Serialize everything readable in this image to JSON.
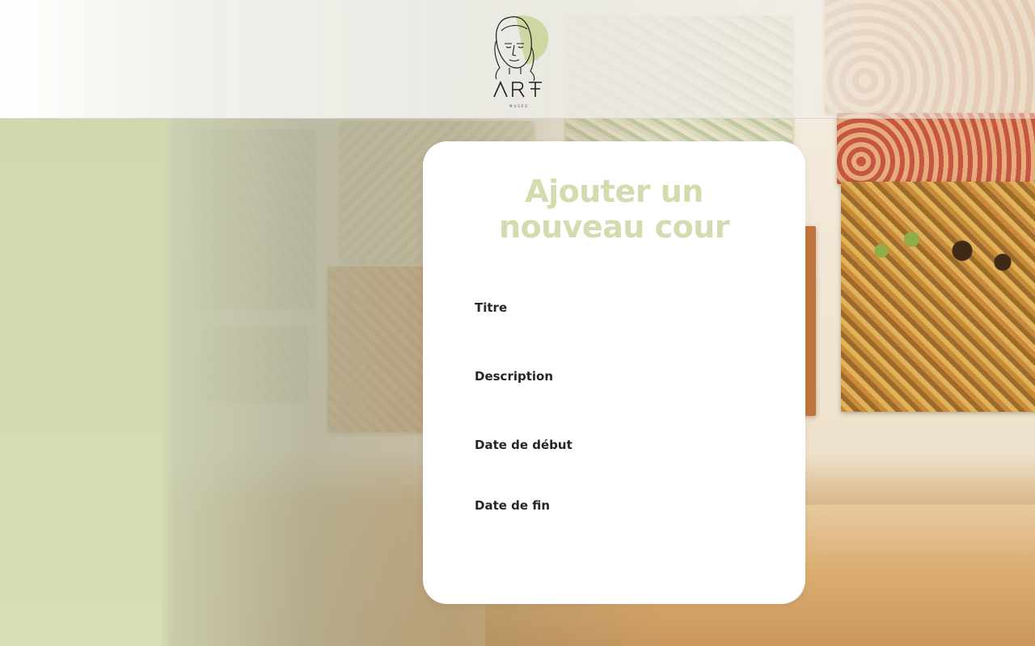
{
  "header": {
    "logo_text": "ART",
    "logo_subtext": "MUSÉE"
  },
  "form": {
    "title_line1": "Ajouter un",
    "title_line2": "nouveau cour",
    "fields": [
      {
        "label": "Titre",
        "value": "",
        "placeholder": ""
      },
      {
        "label": "Description",
        "value": "",
        "placeholder": ""
      },
      {
        "label": "Date de début",
        "value": "",
        "placeholder": ""
      },
      {
        "label": "Date de fin",
        "value": "",
        "placeholder": ""
      }
    ]
  },
  "colors": {
    "accent": "#d3dbaf",
    "sage_panel": "#d1d7ae",
    "label_text": "#23262b",
    "card_bg": "#ffffff"
  }
}
